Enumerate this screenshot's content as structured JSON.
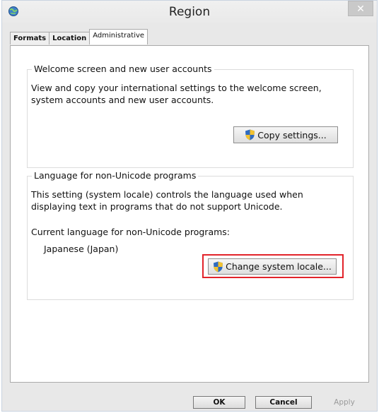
{
  "window": {
    "title": "Region"
  },
  "tabs": [
    {
      "label": "Formats",
      "active": false
    },
    {
      "label": "Location",
      "active": false
    },
    {
      "label": "Administrative",
      "active": true
    }
  ],
  "welcome_group": {
    "title": "Welcome screen and new user accounts",
    "description": "View and copy your international settings to the welcome screen, system accounts and new user accounts.",
    "copy_button": "Copy settings..."
  },
  "unicode_group": {
    "title": "Language for non-Unicode programs",
    "description": "This setting (system locale) controls the language used when displaying text in programs that do not support Unicode.",
    "current_label": "Current language for non-Unicode programs:",
    "current_value": "Japanese (Japan)",
    "change_button": "Change system locale..."
  },
  "footer": {
    "ok": "OK",
    "cancel": "Cancel",
    "apply": "Apply"
  },
  "colors": {
    "highlight": "#e2232a",
    "close_button": "#c9c9c9"
  }
}
